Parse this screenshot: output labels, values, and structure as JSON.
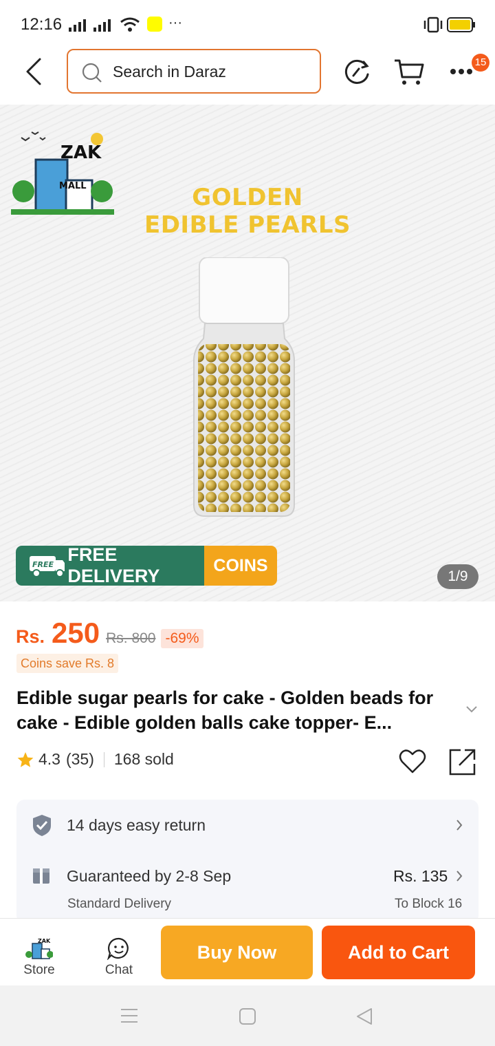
{
  "status_bar": {
    "time": "12:16",
    "dots": "···"
  },
  "header": {
    "search_placeholder": "Search in Daraz",
    "cart_badge": "15"
  },
  "hero": {
    "store_logo_text": "ZAK MALL SHOPPING",
    "headline_line1": "GOLDEN",
    "headline_line2": "EDIBLE PEARLS",
    "banner_free_tag": "FREE",
    "banner_delivery": "FREE DELIVERY",
    "banner_coins": "COINS",
    "image_counter": "1/9"
  },
  "price": {
    "currency": "Rs.",
    "current": "250",
    "original": "Rs. 800",
    "discount": "-69%",
    "coins_save": "Coins save Rs. 8"
  },
  "product": {
    "title": "Edible sugar pearls for cake - Golden beads for cake - Edible golden balls cake topper- E...",
    "rating": "4.3",
    "reviews": "(35)",
    "sold": "168 sold"
  },
  "info": {
    "return_text": "14 days easy return",
    "delivery_text": "Guaranteed by 2-8 Sep",
    "delivery_price": "Rs. 135",
    "delivery_type": "Standard Delivery",
    "delivery_location": "To Block 16"
  },
  "bottom_bar": {
    "store_label": "Store",
    "chat_label": "Chat",
    "buy_now": "Buy Now",
    "add_to_cart": "Add to Cart"
  },
  "colors": {
    "accent": "#f45b1b",
    "buy_now": "#f7a823",
    "add_to_cart": "#f9560f",
    "banner_green": "#2b7a5e"
  }
}
